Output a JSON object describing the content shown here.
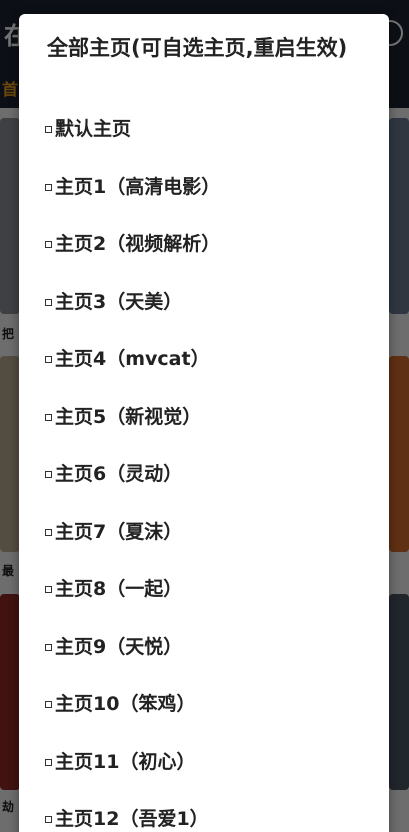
{
  "dialog": {
    "title": "全部主页(可自选主页,重启生效)",
    "options": [
      {
        "label": "默认主页"
      },
      {
        "label": "主页1（高清电影）"
      },
      {
        "label": "主页2（视频解析）"
      },
      {
        "label": "主页3（天美）"
      },
      {
        "label": "主页4（mvcat）"
      },
      {
        "label": "主页5（新视觉）"
      },
      {
        "label": "主页6（灵动）"
      },
      {
        "label": "主页7（夏沫）"
      },
      {
        "label": "主页8（一起）"
      },
      {
        "label": "主页9（天悦）"
      },
      {
        "label": "主页10（笨鸡）"
      },
      {
        "label": "主页11（初心）"
      },
      {
        "label": "主页12（吾爱1）"
      }
    ]
  },
  "background": {
    "app_title_glyph": "在",
    "nav_tab_glyph": "首",
    "captions": [
      "把",
      "最",
      "劫"
    ]
  },
  "colors": {
    "topbar": "#1c2330",
    "nav_accent": "#f0a020",
    "dialog_bg": "#ffffff",
    "text": "#222222"
  }
}
